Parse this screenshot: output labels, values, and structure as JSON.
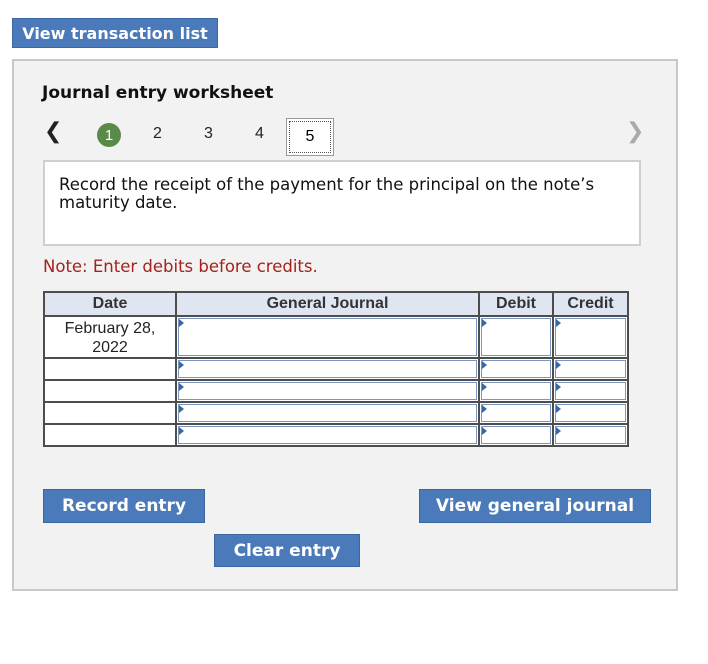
{
  "top_button": {
    "label": "View transaction list"
  },
  "worksheet": {
    "title": "Journal entry worksheet",
    "steps": [
      "1",
      "2",
      "3",
      "4",
      "5"
    ],
    "current_step": "5",
    "prev_icon": "chevron-left-icon",
    "next_icon": "chevron-right-icon",
    "instruction": "Record the receipt of the payment for the principal on the note’s maturity date.",
    "note": "Note: Enter debits before credits."
  },
  "table": {
    "headers": {
      "date": "Date",
      "journal": "General Journal",
      "debit": "Debit",
      "credit": "Credit"
    },
    "rows": [
      {
        "date": "February 28, 2022",
        "journal": "",
        "debit": "",
        "credit": ""
      },
      {
        "date": "",
        "journal": "",
        "debit": "",
        "credit": ""
      },
      {
        "date": "",
        "journal": "",
        "debit": "",
        "credit": ""
      },
      {
        "date": "",
        "journal": "",
        "debit": "",
        "credit": ""
      },
      {
        "date": "",
        "journal": "",
        "debit": "",
        "credit": ""
      }
    ]
  },
  "buttons": {
    "record_entry": "Record entry",
    "clear_entry": "Clear entry",
    "view_general_journal": "View general journal"
  },
  "colors": {
    "accent": "#4a7ab9",
    "note": "#a3221c",
    "step_active": "#5a8a4a"
  }
}
